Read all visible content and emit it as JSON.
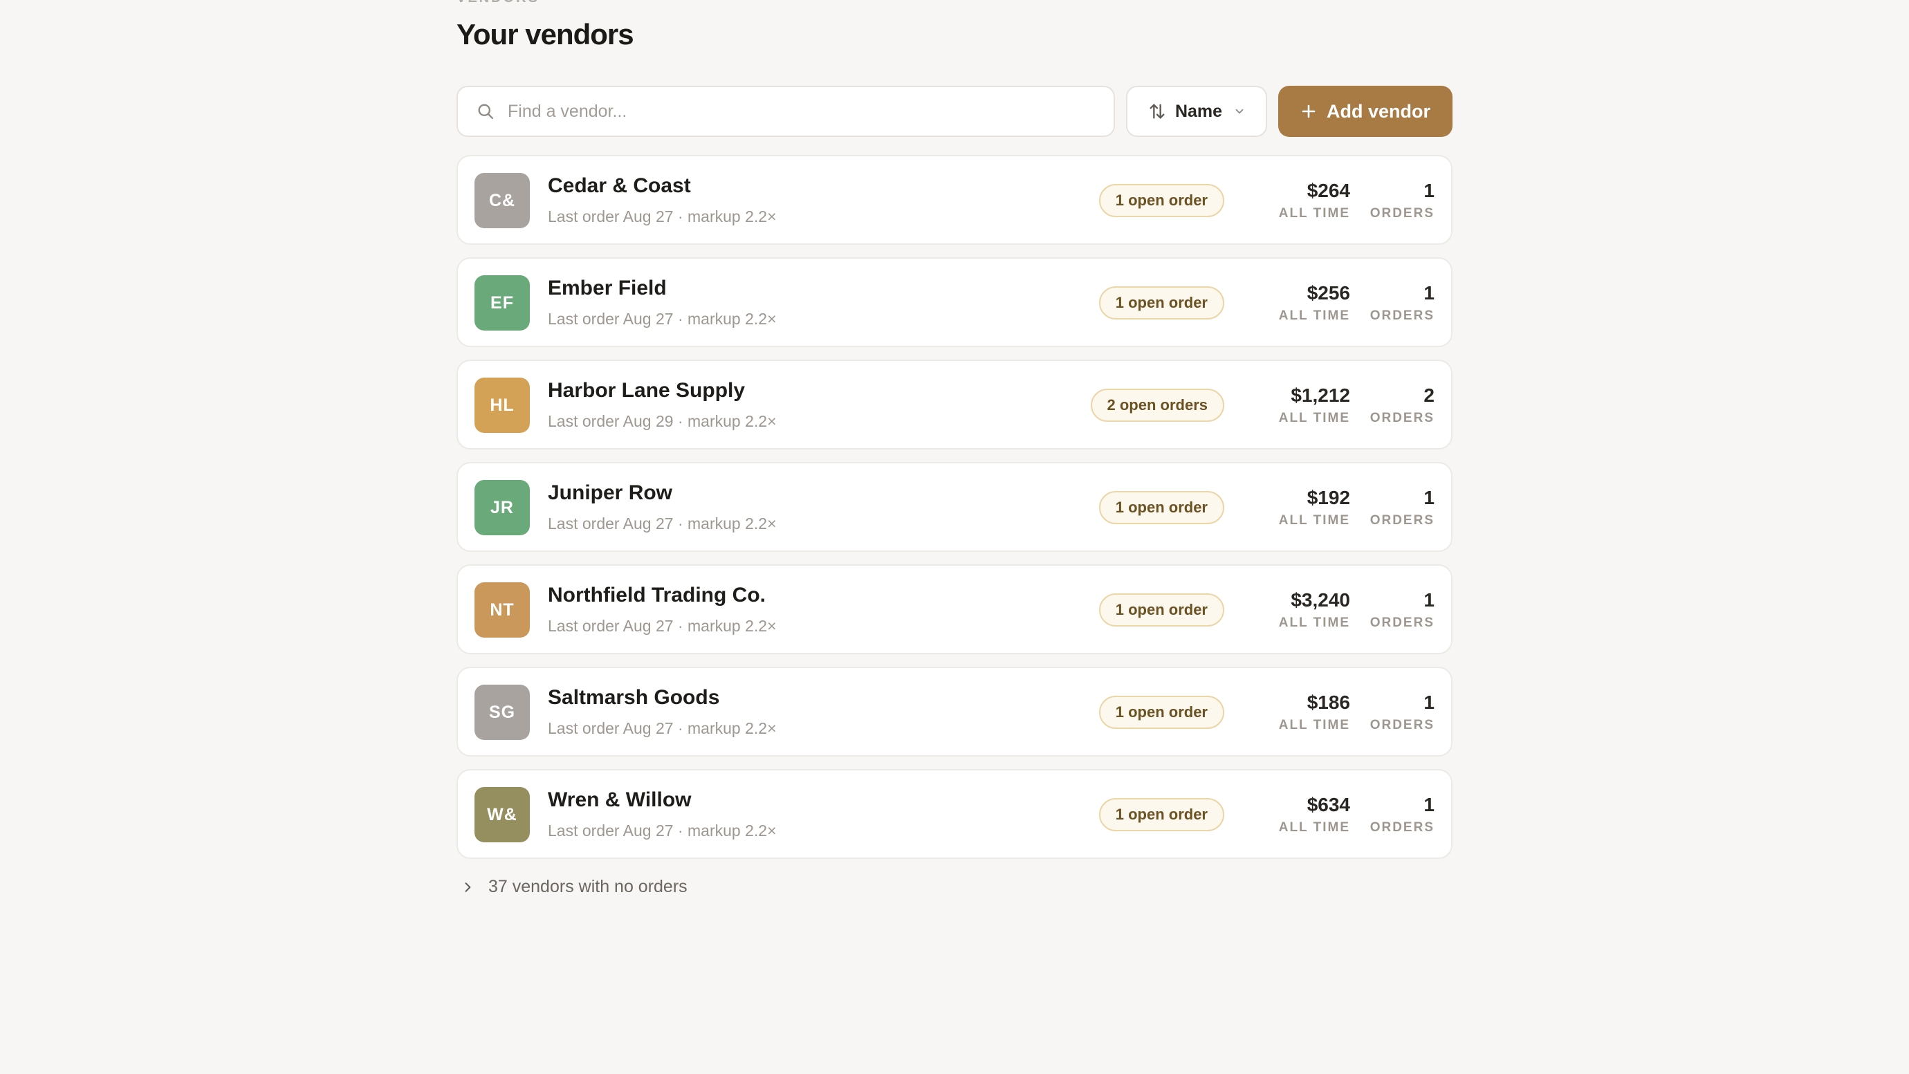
{
  "header": {
    "eyebrow": "VENDORS",
    "title": "Your vendors"
  },
  "toolbar": {
    "search_placeholder": "Find a vendor...",
    "sort_label": "Name",
    "add_label": "Add vendor"
  },
  "vendors": [
    {
      "initials": "C&",
      "name": "Cedar & Coast",
      "meta": "Last order Aug 27 · markup 2.2×",
      "badge": "1 open order",
      "spent": "$264",
      "spent_label": "ALL TIME",
      "orders": "1",
      "orders_label": "ORDERS",
      "color": "#a8a39e"
    },
    {
      "initials": "EF",
      "name": "Ember Field",
      "meta": "Last order Aug 27 · markup 2.2×",
      "badge": "1 open order",
      "spent": "$256",
      "spent_label": "ALL TIME",
      "orders": "1",
      "orders_label": "ORDERS",
      "color": "#6aa97a"
    },
    {
      "initials": "HL",
      "name": "Harbor Lane Supply",
      "meta": "Last order Aug 29 · markup 2.2×",
      "badge": "2 open orders",
      "spent": "$1,212",
      "spent_label": "ALL TIME",
      "orders": "2",
      "orders_label": "ORDERS",
      "color": "#d4a256"
    },
    {
      "initials": "JR",
      "name": "Juniper Row",
      "meta": "Last order Aug 27 · markup 2.2×",
      "badge": "1 open order",
      "spent": "$192",
      "spent_label": "ALL TIME",
      "orders": "1",
      "orders_label": "ORDERS",
      "color": "#6aa97a"
    },
    {
      "initials": "NT",
      "name": "Northfield Trading Co.",
      "meta": "Last order Aug 27 · markup 2.2×",
      "badge": "1 open order",
      "spent": "$3,240",
      "spent_label": "ALL TIME",
      "orders": "1",
      "orders_label": "ORDERS",
      "color": "#c9985a"
    },
    {
      "initials": "SG",
      "name": "Saltmarsh Goods",
      "meta": "Last order Aug 27 · markup 2.2×",
      "badge": "1 open order",
      "spent": "$186",
      "spent_label": "ALL TIME",
      "orders": "1",
      "orders_label": "ORDERS",
      "color": "#a8a39e"
    },
    {
      "initials": "W&",
      "name": "Wren & Willow",
      "meta": "Last order Aug 27 · markup 2.2×",
      "badge": "1 open order",
      "spent": "$634",
      "spent_label": "ALL TIME",
      "orders": "1",
      "orders_label": "ORDERS",
      "color": "#958e5e"
    }
  ],
  "footer": {
    "no_orders_label": "37 vendors with no orders"
  },
  "colors": {
    "accent": "#a87a44",
    "badge_border": "#ecd6a8",
    "background": "#f7f6f4"
  }
}
